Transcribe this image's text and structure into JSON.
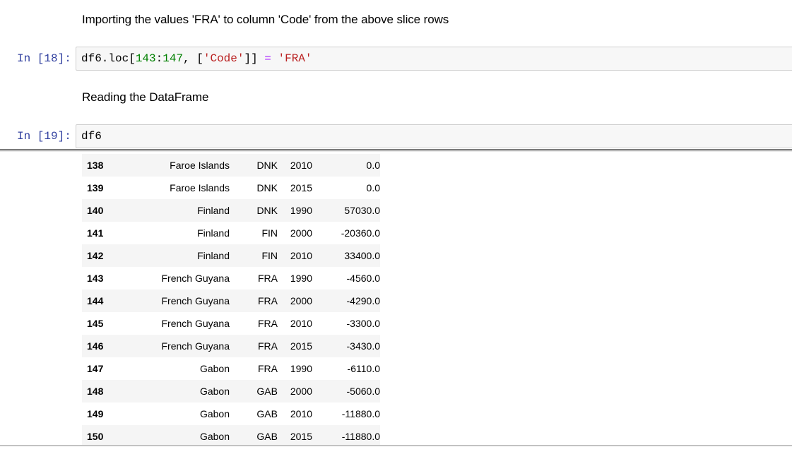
{
  "markdown_1": "Importing the values 'FRA' to column 'Code' from the above slice rows",
  "cell_18": {
    "prompt": "In [18]:",
    "code": {
      "a": "df6.loc[",
      "n1": "143",
      "colon": ":",
      "n2": "147",
      "b": ", [",
      "s1": "'Code'",
      "c": "]] ",
      "op": "=",
      "d": " ",
      "s2": "'FRA'"
    }
  },
  "markdown_2": "Reading the DataFrame",
  "cell_19": {
    "prompt": "In [19]:",
    "code": "df6"
  },
  "output_table": {
    "rows": [
      {
        "index": "138",
        "name": "Faroe Islands",
        "code": "DNK",
        "year": "2010",
        "value": "0.0"
      },
      {
        "index": "139",
        "name": "Faroe Islands",
        "code": "DNK",
        "year": "2015",
        "value": "0.0"
      },
      {
        "index": "140",
        "name": "Finland",
        "code": "DNK",
        "year": "1990",
        "value": "57030.0"
      },
      {
        "index": "141",
        "name": "Finland",
        "code": "FIN",
        "year": "2000",
        "value": "-20360.0"
      },
      {
        "index": "142",
        "name": "Finland",
        "code": "FIN",
        "year": "2010",
        "value": "33400.0"
      },
      {
        "index": "143",
        "name": "French Guyana",
        "code": "FRA",
        "year": "1990",
        "value": "-4560.0"
      },
      {
        "index": "144",
        "name": "French Guyana",
        "code": "FRA",
        "year": "2000",
        "value": "-4290.0"
      },
      {
        "index": "145",
        "name": "French Guyana",
        "code": "FRA",
        "year": "2010",
        "value": "-3300.0"
      },
      {
        "index": "146",
        "name": "French Guyana",
        "code": "FRA",
        "year": "2015",
        "value": "-3430.0"
      },
      {
        "index": "147",
        "name": "Gabon",
        "code": "FRA",
        "year": "1990",
        "value": "-6110.0"
      },
      {
        "index": "148",
        "name": "Gabon",
        "code": "GAB",
        "year": "2000",
        "value": "-5060.0"
      },
      {
        "index": "149",
        "name": "Gabon",
        "code": "GAB",
        "year": "2010",
        "value": "-11880.0"
      },
      {
        "index": "150",
        "name": "Gabon",
        "code": "GAB",
        "year": "2015",
        "value": "-11880.0"
      }
    ]
  }
}
